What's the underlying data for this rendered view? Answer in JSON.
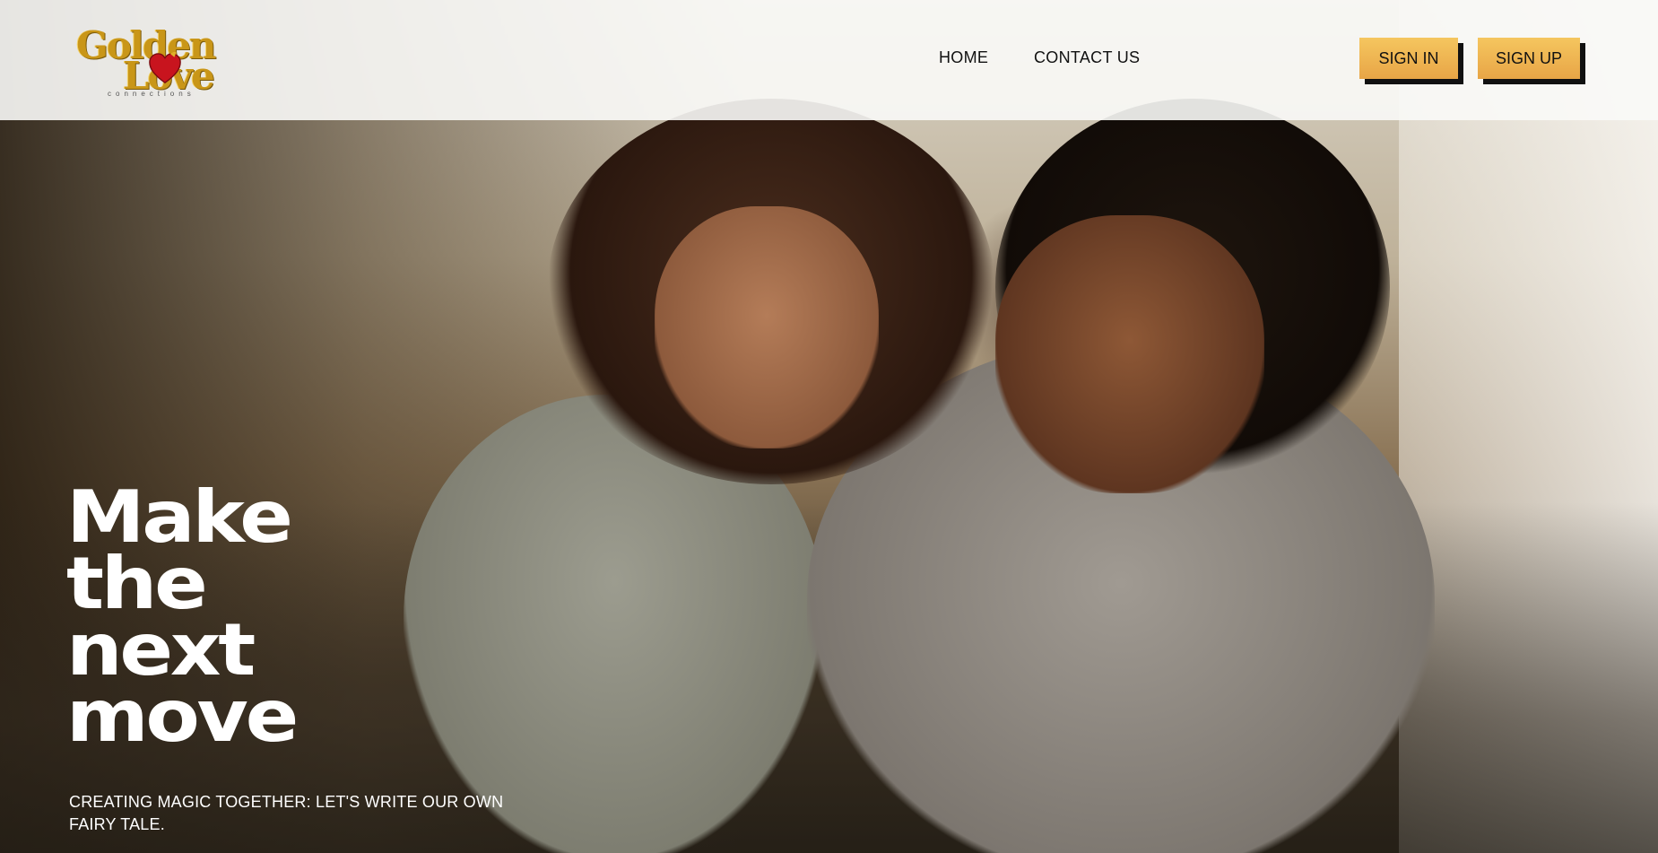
{
  "header": {
    "logo": {
      "word1": "Golden",
      "word2": "Love",
      "tagline": "connections",
      "icon": "heart-icon",
      "gold_color": "#c99618",
      "heart_color": "#c8141e"
    },
    "nav": {
      "home": "HOME",
      "contact": "CONTACT US"
    },
    "buttons": {
      "sign_in": "SIGN IN",
      "sign_up": "SIGN UP",
      "accent_color": "#f0b550"
    }
  },
  "hero": {
    "title_lines": [
      "Make",
      "the",
      "next",
      "move"
    ],
    "subtitle": "CREATING MAGIC TOGETHER: LET'S WRITE OUR OWN FAIRY TALE.",
    "image": "smiling-couple-photo"
  }
}
